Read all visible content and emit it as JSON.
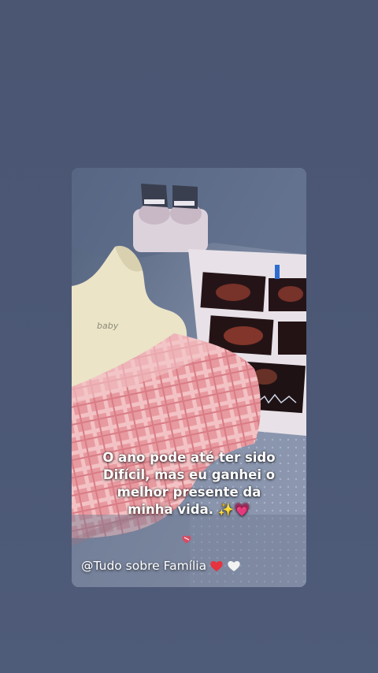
{
  "story": {
    "caption_lines": [
      "O ano pode até ter sido",
      "Difícil, mas eu ganhei o",
      "melhor presente da",
      "minha vida. ✨💗"
    ],
    "credit_text": "@Tudo sobre Família"
  },
  "icons": {
    "small_heart": "pink-heart-icon",
    "credit_hearts": [
      "red-heart-icon",
      "white-heart-icon"
    ]
  },
  "colors": {
    "page_background": "#4b5774",
    "caption_text": "#ffffff",
    "red_heart": "#e5333f",
    "white_heart": "#f2f2f2"
  }
}
